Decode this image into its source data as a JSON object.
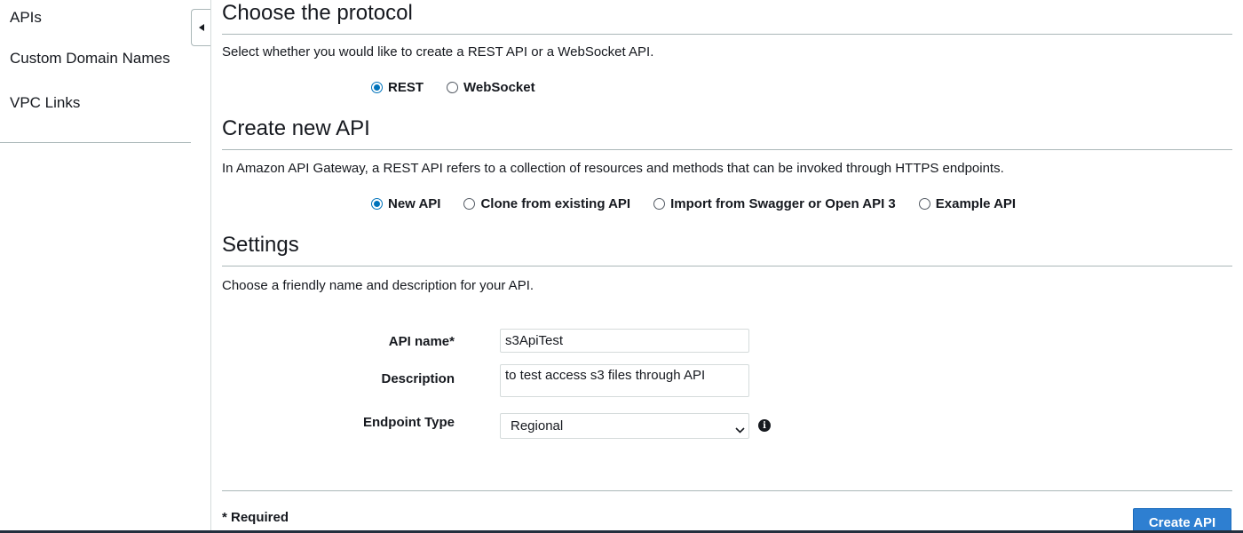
{
  "sidebar": {
    "items": [
      {
        "label": "APIs"
      },
      {
        "label": "Custom Domain Names"
      },
      {
        "label": "VPC Links"
      }
    ]
  },
  "protocol": {
    "title": "Choose the protocol",
    "description": "Select whether you would like to create a REST API or a WebSocket API.",
    "options": [
      {
        "label": "REST",
        "checked": true
      },
      {
        "label": "WebSocket",
        "checked": false
      }
    ]
  },
  "create_api": {
    "title": "Create new API",
    "description": "In Amazon API Gateway, a REST API refers to a collection of resources and methods that can be invoked through HTTPS endpoints.",
    "options": [
      {
        "label": "New API",
        "checked": true
      },
      {
        "label": "Clone from existing API",
        "checked": false
      },
      {
        "label": "Import from Swagger or Open API 3",
        "checked": false
      },
      {
        "label": "Example API",
        "checked": false
      }
    ]
  },
  "settings": {
    "title": "Settings",
    "description": "Choose a friendly name and description for your API.",
    "api_name_label": "API name*",
    "api_name_value": "s3ApiTest",
    "description_label": "Description",
    "description_value": "to test access s3 files through API",
    "endpoint_type_label": "Endpoint Type",
    "endpoint_type_value": "Regional"
  },
  "footer": {
    "required_note": "* Required",
    "create_button_label": "Create API"
  },
  "colors": {
    "accent": "#0073bb",
    "primary_button": "#2e7fd1",
    "rule": "#aab7b8"
  },
  "icons": {
    "collapse": "caret-left-icon",
    "select": "chevron-down-icon",
    "info": "info-icon"
  }
}
